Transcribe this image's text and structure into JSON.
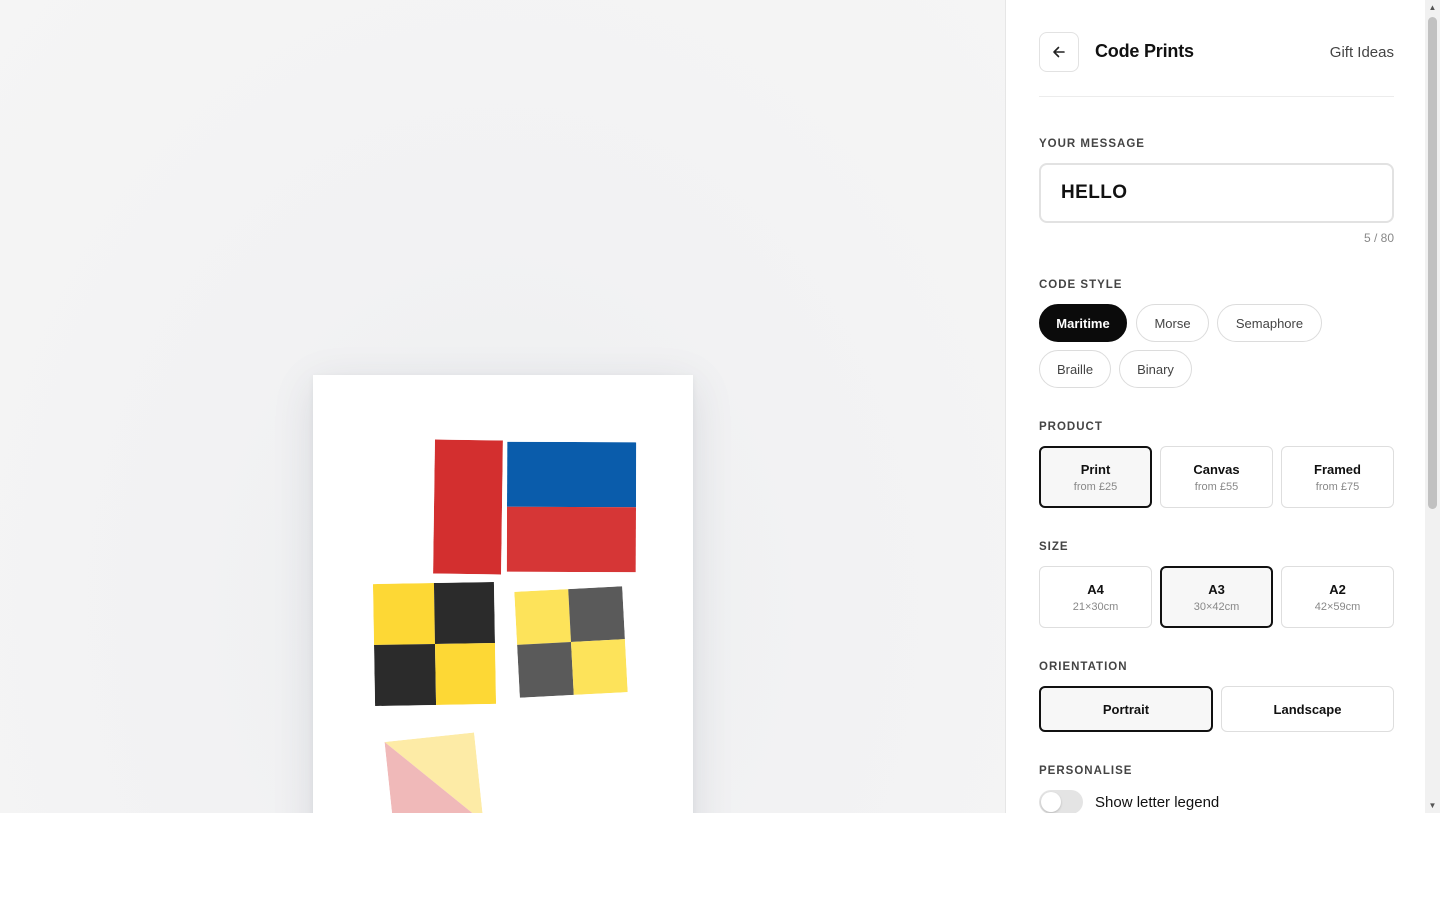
{
  "header": {
    "title": "Code Prints",
    "link_label": "Gift Ideas",
    "back_icon": "arrow-left-icon"
  },
  "message": {
    "label": "YOUR MESSAGE",
    "value": "HELLO",
    "char_count": "5 / 80"
  },
  "code_style": {
    "label": "CODE STYLE",
    "options": [
      "Maritime",
      "Morse",
      "Semaphore",
      "Braille",
      "Binary"
    ],
    "selected": "Maritime"
  },
  "product": {
    "label": "PRODUCT",
    "options": [
      {
        "title": "Print",
        "price": "from £25"
      },
      {
        "title": "Canvas",
        "price": "from £55"
      },
      {
        "title": "Framed",
        "price": "from £75"
      }
    ],
    "selected": "Print"
  },
  "size": {
    "label": "SIZE",
    "options": [
      {
        "title": "A4",
        "dims": "21×30cm"
      },
      {
        "title": "A3",
        "dims": "30×42cm"
      },
      {
        "title": "A2",
        "dims": "42×59cm"
      }
    ],
    "selected": "A3"
  },
  "orientation": {
    "label": "ORIENTATION",
    "options": [
      "Portrait",
      "Landscape"
    ],
    "selected": "Portrait"
  },
  "personalise": {
    "label": "PERSONALISE",
    "toggle_label": "Show letter legend",
    "toggle_on": false
  },
  "preview": {
    "flags": [
      {
        "letter": "H",
        "colors": [
          "#d32f2f"
        ]
      },
      {
        "letter": "E",
        "colors": [
          "#0a5cab",
          "#d63636"
        ]
      },
      {
        "letter": "L",
        "colors": [
          "#fdd835",
          "#2b2b2b"
        ]
      },
      {
        "letter": "L",
        "colors": [
          "#fde35a",
          "#5a5a5a"
        ]
      },
      {
        "letter": "O",
        "colors": [
          "#f0b9b9",
          "#fdeba6"
        ]
      }
    ]
  },
  "colors": {
    "accent": "#0b0b0b",
    "border": "#dedede"
  }
}
